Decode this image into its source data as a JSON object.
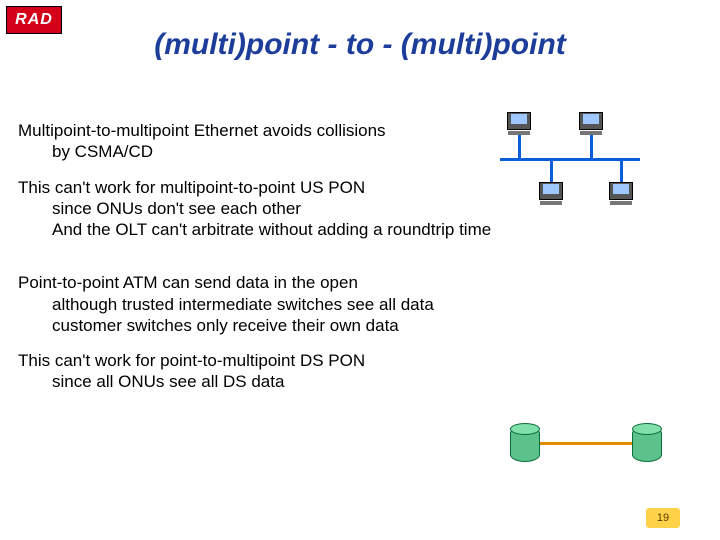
{
  "logo": {
    "text": "RAD"
  },
  "title": "(multi)point - to - (multi)point",
  "paragraphs": {
    "p1": {
      "l1": "Multipoint-to-multipoint Ethernet avoids collisions",
      "l2": "by CSMA/CD"
    },
    "p2": {
      "l1": "This can't work for multipoint-to-point US PON",
      "l2": "since ONUs don't see each other",
      "l3": "And the OLT can't arbitrate without adding a roundtrip time"
    },
    "p3": {
      "l1": "Point-to-point ATM can send data in the open",
      "l2": "although trusted intermediate switches see all data",
      "l3": "customer switches only receive their own data"
    },
    "p4": {
      "l1": "This can't work for point-to-multipoint DS PON",
      "l2": "since all ONUs see all DS data"
    }
  },
  "page_number": "19"
}
